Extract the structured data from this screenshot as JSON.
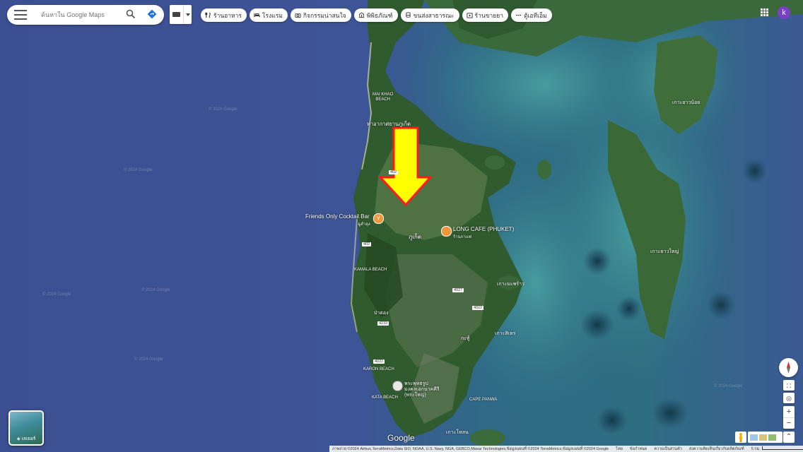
{
  "search": {
    "placeholder": "ค้นหาใน Google Maps"
  },
  "chips": [
    {
      "label": "ร้านอาหาร",
      "icon": "restaurant-icon"
    },
    {
      "label": "โรงแรม",
      "icon": "hotel-icon"
    },
    {
      "label": "กิจกรรมน่าสนใจ",
      "icon": "camera-icon"
    },
    {
      "label": "พิพิธภัณฑ์",
      "icon": "museum-icon"
    },
    {
      "label": "ขนส่งสาธารณะ",
      "icon": "transit-icon"
    },
    {
      "label": "ร้านขายยา",
      "icon": "pharmacy-icon"
    },
    {
      "label": "ตู้เอทีเอ็ม",
      "icon": "atm-icon"
    }
  ],
  "account": {
    "initial": "k"
  },
  "layers": {
    "label": "เลเยอร์"
  },
  "places": {
    "bar": {
      "name": "Friends Only Cocktail Bar",
      "sub": "ฉูลำลุง"
    },
    "cafe": {
      "name": "LONG CAFE (PHUKET)",
      "sub": "ร้านกาแฟ"
    },
    "temple": {
      "name": "พระพุทธรูป",
      "line2": "มงคลเอกนาคคีรี",
      "line3": "(พระใหญ่)"
    }
  },
  "labels": {
    "mai_khao": "MAI KHAO",
    "beach": "BEACH",
    "airport": "ท่าอากาศยานภูเก็ต",
    "kamala": "KAMALA BEACH",
    "karon": "KARON BEACH",
    "kata": "KATA BEACH",
    "panwa": "CAPE PANWA",
    "phuket": "ภูเก็ต",
    "yao_noi": "เกาะยาวน้อย",
    "yao_yai": "เกาะยาวใหญ่",
    "ko_maphrao": "เกาะมะพร้าว",
    "ko_sire": "เกาะสิเหร่",
    "ko_lon": "เกาะโหลน",
    "patong": "ป่าตอง",
    "kathu": "กะทู้",
    "road_402": "402",
    "road_4027": "4027",
    "road_4022": "4022",
    "road_4233": "4233",
    "watermark": "© 2024 Google"
  },
  "logo": "Google",
  "footer": {
    "imagery": "ภาพถ่าย ©2024 Airbus,TerraMetrics,Data SIO, NOAA, U.S. Navy, NGA, GEBCO,Maxar Technologies,ข้อมูลแผนที่ ©2024 TerraMetrics,ข้อมูลแผนที่ ©2024 Google",
    "country": "ไทย",
    "terms": "ข้อกำหนด",
    "privacy": "ความเป็นส่วนตัว",
    "feedback": "ส่งความคิดเห็นเกี่ยวกับผลิตภัณฑ์",
    "scale": "5 กม."
  },
  "colors": {
    "arrow_fill": "#ffff00",
    "arrow_outline": "#ff1a1a",
    "place_pin": "#f2963a",
    "ocean": "#3e5394",
    "land": "#2f5c2e"
  }
}
